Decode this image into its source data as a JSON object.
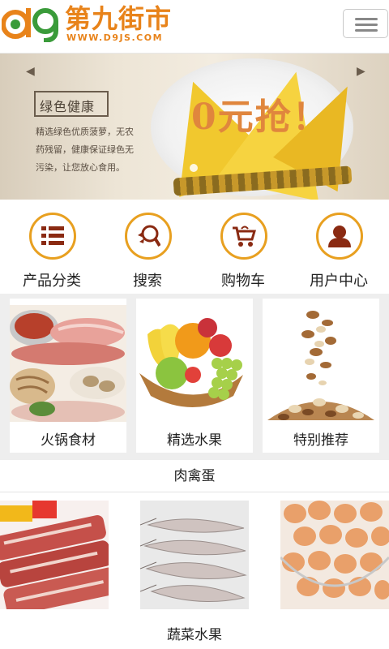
{
  "header": {
    "title": "第九街市",
    "url": "WWW.D9JS.COM"
  },
  "banner": {
    "heading": "绿色健康",
    "description": "精选绿色优质菠萝，无农药残留，健康保证绿色无污染，让您放心食用。",
    "promo": "0元抢！"
  },
  "quicknav": [
    {
      "label": "产品分类",
      "icon": "list-icon"
    },
    {
      "label": "搜索",
      "icon": "search-icon"
    },
    {
      "label": "购物车",
      "icon": "cart-icon"
    },
    {
      "label": "用户中心",
      "icon": "user-icon"
    }
  ],
  "categories": [
    {
      "label": "火锅食材"
    },
    {
      "label": "精选水果"
    },
    {
      "label": "特别推荐"
    }
  ],
  "sections": [
    {
      "title": "肉禽蛋"
    },
    {
      "title": "蔬菜水果"
    }
  ],
  "colors": {
    "accent": "#e8a020",
    "brand": "#e8831a"
  }
}
